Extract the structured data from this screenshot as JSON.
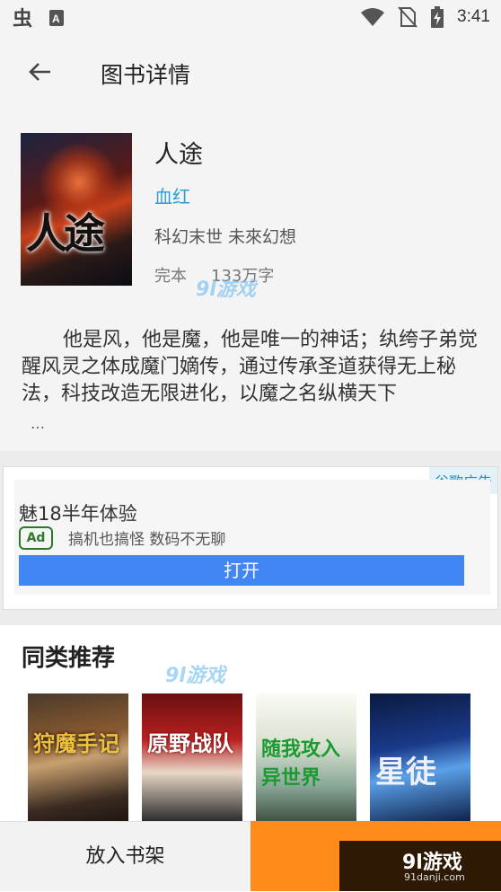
{
  "status_bar": {
    "time": "3:41",
    "icons": [
      "bug-icon",
      "a-box-icon",
      "wifi-icon",
      "no-sim-icon",
      "battery-charging-icon"
    ]
  },
  "toolbar": {
    "title": "图书详情",
    "back_icon": "arrow-left-icon"
  },
  "book": {
    "cover_text": "人途",
    "name": "人途",
    "author": "血红",
    "tags": "科幻末世 未來幻想",
    "status": "完本",
    "words": "133万字",
    "description": "他是风，他是魔，他是唯一的神话；纨绔子弟觉醒风灵之体成魔门嫡传，通过传承圣道获得无上秘法，科技改造无限进化，以魔之名纵横天下",
    "ellipsis": "…"
  },
  "ad": {
    "badge": "谷歌广告",
    "title": "魅18半年体验",
    "label": "Ad",
    "subtitle": "搞机也搞怪 数码不无聊",
    "button": "打开",
    "button_color": "#4285f4"
  },
  "recommend": {
    "title": "同类推荐",
    "items": [
      {
        "cover_text": "狩魔手记"
      },
      {
        "cover_text": "原野战队"
      },
      {
        "cover_text": "随我攻入异世界"
      },
      {
        "cover_text": "星徒"
      }
    ]
  },
  "bottom": {
    "add_shelf": "放入书架",
    "read_color": "#ff8b1d"
  },
  "watermark": {
    "text": "9l游戏",
    "sub": "91danji.com"
  }
}
